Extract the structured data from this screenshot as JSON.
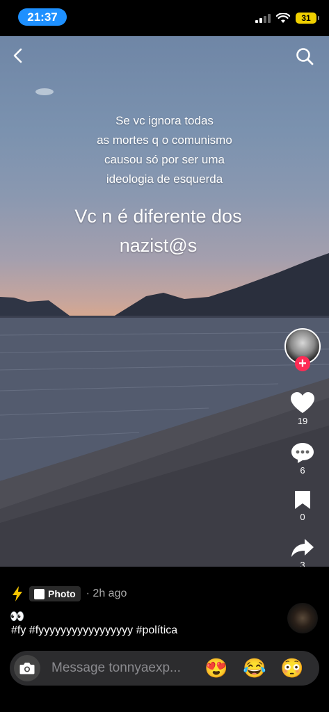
{
  "status_bar": {
    "time": "21:37",
    "battery": "31"
  },
  "overlay": {
    "line1": "Se vc ignora todas",
    "line2": "as mortes q o comunismo",
    "line3": "causou só por ser uma",
    "line4": "ideologia de esquerda",
    "big_line1": "Vc n é diferente dos",
    "big_line2": "nazist@s"
  },
  "side_actions": {
    "likes": "19",
    "comments": "6",
    "bookmarks": "0",
    "shares": "3"
  },
  "post": {
    "badge": "Photo",
    "time_ago": "· 2h ago",
    "emoji_line": "👀",
    "hashtags": "#fy #fyyyyyyyyyyyyyyyyy #política"
  },
  "message_bar": {
    "placeholder": "Message tonnyaexp...",
    "emoji1": "😍",
    "emoji2": "😂",
    "emoji3": "😳"
  },
  "icons": [
    "back-icon",
    "search-icon",
    "heart-icon",
    "comment-icon",
    "bookmark-icon",
    "share-icon",
    "camera-icon",
    "lightning-icon"
  ],
  "colors": {
    "accent_time": "#1e90ff",
    "follow": "#fe2c55",
    "battery": "#f0d000"
  }
}
